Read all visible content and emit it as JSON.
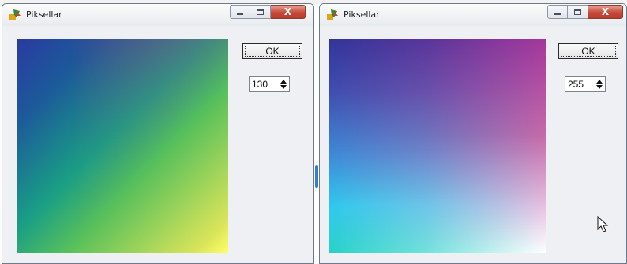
{
  "windows": [
    {
      "title": "Piksellar",
      "ok_label": "OK",
      "spin_value": "130",
      "caption_buttons": [
        "minimize-icon",
        "maximize-icon",
        "close-icon"
      ],
      "close_glyph": "X"
    },
    {
      "title": "Piksellar",
      "ok_label": "OK",
      "spin_value": "255",
      "caption_buttons": [
        "minimize-icon",
        "maximize-icon",
        "close-icon"
      ],
      "close_glyph": "X"
    }
  ],
  "colors": {
    "close_button": "#c74b3a",
    "window_bg": "#eef0f3",
    "left_gradient": [
      "#2a3aa0",
      "#1a9f85",
      "#e81e78",
      "#ffff66"
    ],
    "right_gradient": [
      "#32349a",
      "#2fc8ee",
      "#a5379c",
      "#ffffff"
    ]
  }
}
